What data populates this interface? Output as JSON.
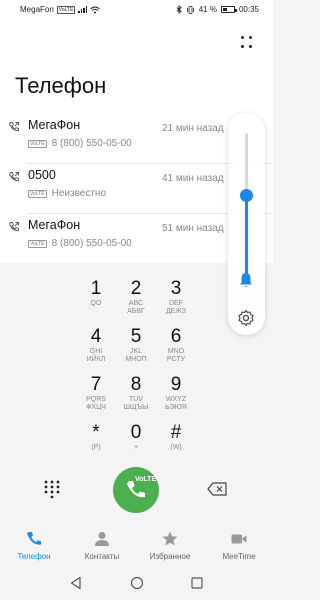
{
  "status_bar": {
    "carrier": "MegaFon",
    "network_badge": "VoLTE",
    "icons": [
      "signal-icon",
      "wifi-icon",
      "bluetooth-icon",
      "vibrate-icon"
    ],
    "battery": "41 %",
    "battery_level": 0.41,
    "time": "00:35"
  },
  "header": {
    "title": "Телефон",
    "menu_icon": "more-dots-icon"
  },
  "recent_calls": [
    {
      "name": "МегаФон",
      "sim_badge": "VoLTE",
      "number": "8 (800) 550-05-00",
      "time": "21 мин назад"
    },
    {
      "name": "0500",
      "sim_badge": "VoLTE",
      "number": "Неизвестно",
      "time": "41 мин назад"
    },
    {
      "name": "МегаФон",
      "sim_badge": "VoLTE",
      "number": "8 (800) 550-05-00",
      "time": "51 мин назад"
    }
  ],
  "volume_panel": {
    "level": 0.56,
    "accent_color": "#1e88e5",
    "icons": [
      "bell-icon",
      "gear-icon"
    ]
  },
  "dialpad": {
    "keys": [
      {
        "digit": "1",
        "latin": "QO",
        "cyr": ""
      },
      {
        "digit": "2",
        "latin": "ABC",
        "cyr": "АБВГ"
      },
      {
        "digit": "3",
        "latin": "DEF",
        "cyr": "ДЕЖЗ"
      },
      {
        "digit": "4",
        "latin": "GHI",
        "cyr": "ИЙКЛ"
      },
      {
        "digit": "5",
        "latin": "JKL",
        "cyr": "МНОП"
      },
      {
        "digit": "6",
        "latin": "MNO",
        "cyr": "РСТУ"
      },
      {
        "digit": "7",
        "latin": "PQRS",
        "cyr": "ФХЦЧ"
      },
      {
        "digit": "8",
        "latin": "TUV",
        "cyr": "ШЩЪЫ"
      },
      {
        "digit": "9",
        "latin": "WXYZ",
        "cyr": "ЬЭЮЯ"
      },
      {
        "digit": "*",
        "latin": "(P)",
        "cyr": ""
      },
      {
        "digit": "0",
        "latin": "+",
        "cyr": ""
      },
      {
        "digit": "#",
        "latin": "(W)",
        "cyr": ""
      }
    ],
    "call_button_label": "VoLTE",
    "call_color": "#4caf50"
  },
  "bottom_nav": [
    {
      "label": "Телефон",
      "icon": "phone-icon",
      "active": true
    },
    {
      "label": "Контакты",
      "icon": "contacts-icon",
      "active": false
    },
    {
      "label": "Избранное",
      "icon": "star-icon",
      "active": false
    },
    {
      "label": "MeeTime",
      "icon": "video-camera-icon",
      "active": false
    }
  ],
  "system_nav": [
    "back-icon",
    "home-icon",
    "recents-icon"
  ]
}
